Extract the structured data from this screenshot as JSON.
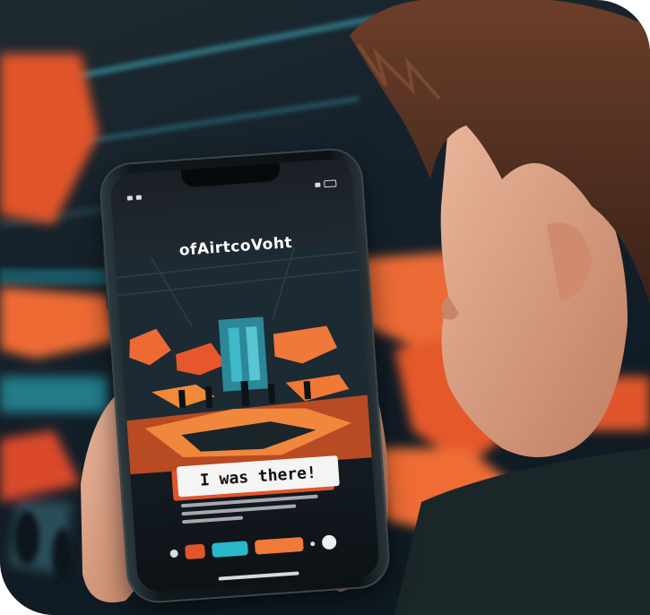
{
  "photo": {
    "subject": "person holding smartphone",
    "colors": {
      "accent_orange": "#e8582a",
      "accent_teal": "#2fb7c9",
      "background": "#14202a"
    }
  },
  "phone_screen": {
    "app_title": "ofAirtcoVoht",
    "banner_text": "I was there!"
  }
}
